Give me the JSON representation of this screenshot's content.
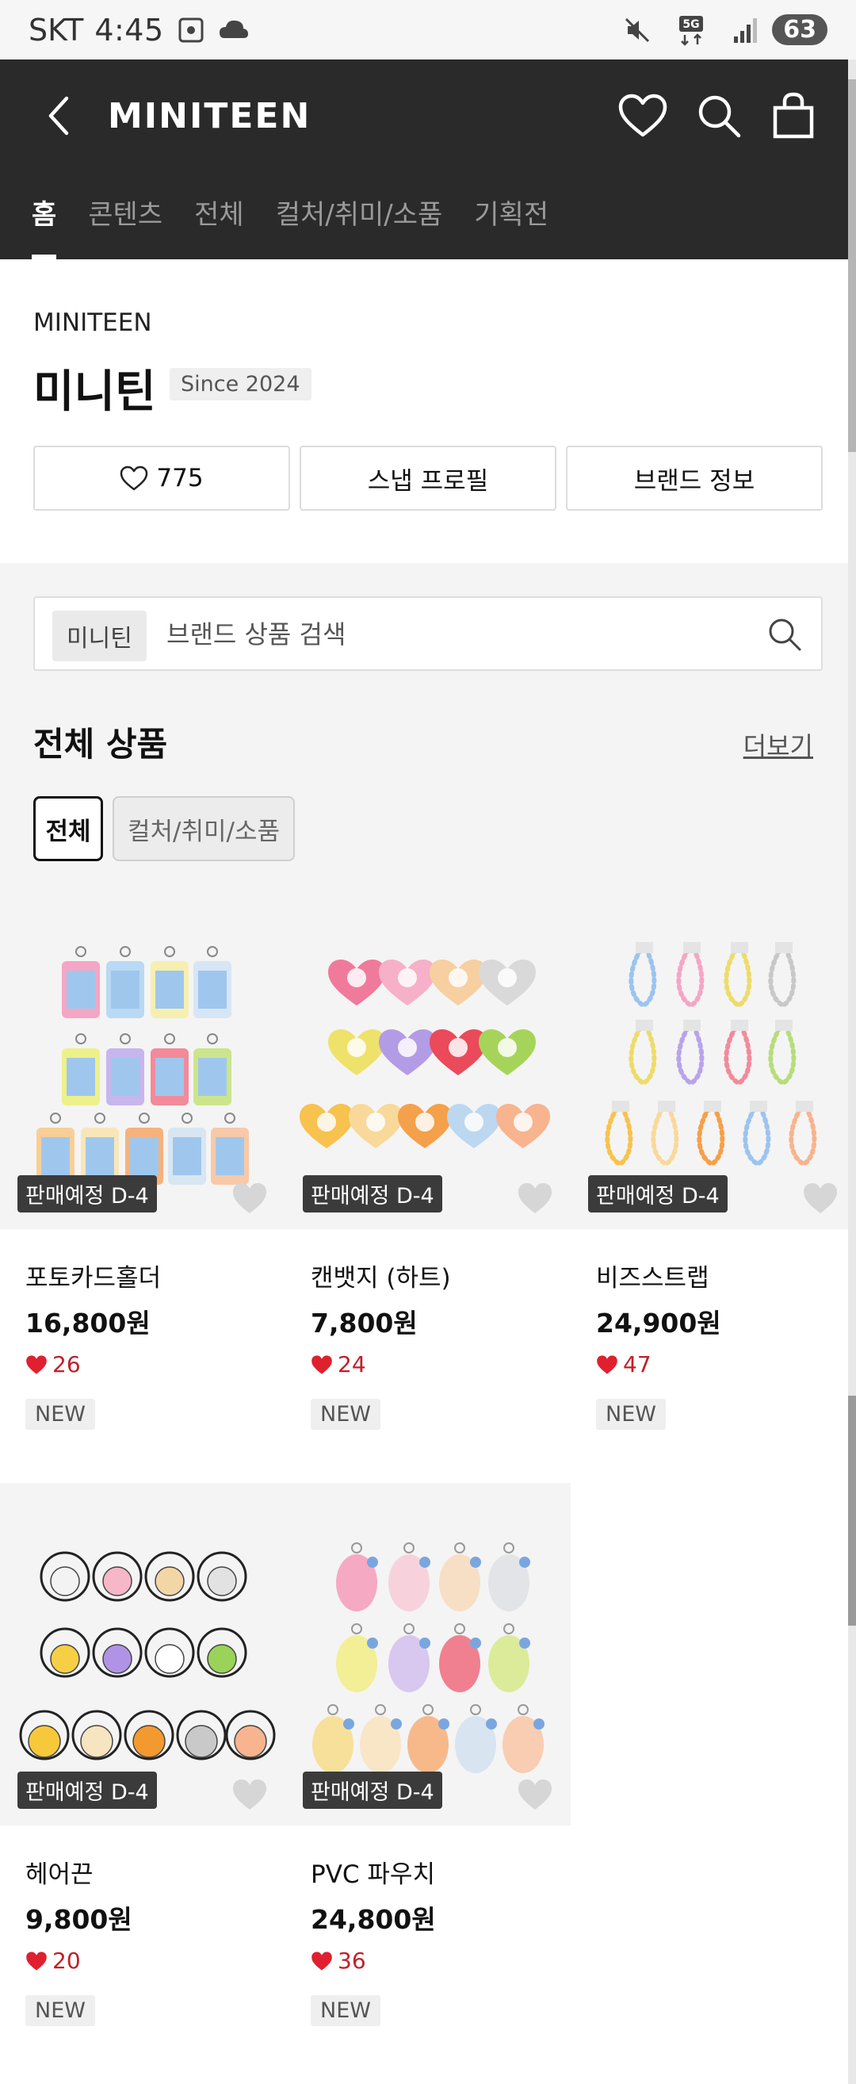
{
  "status_bar": {
    "carrier": "SKT",
    "time": "4:45",
    "battery": "63",
    "network": "5G"
  },
  "header": {
    "logo_text": "MINITEEN",
    "tabs": [
      {
        "label": "홈",
        "active": true
      },
      {
        "label": "콘텐츠",
        "active": false
      },
      {
        "label": "전체",
        "active": false
      },
      {
        "label": "컬처/취미/소품",
        "active": false
      },
      {
        "label": "기획전",
        "active": false
      }
    ]
  },
  "brand": {
    "name_en": "MINITEEN",
    "name_ko": "미니틴",
    "since": "Since 2024",
    "like_count": "775",
    "snap_profile_label": "스냅 프로필",
    "brand_info_label": "브랜드 정보"
  },
  "search": {
    "chip": "미니틴",
    "placeholder": "브랜드 상품 검색"
  },
  "section": {
    "title": "전체 상품",
    "more_label": "더보기",
    "filters": [
      {
        "label": "전체",
        "active": true
      },
      {
        "label": "컬처/취미/소품",
        "active": false
      }
    ]
  },
  "products": [
    {
      "name": "포토카드홀더",
      "price": "16,800원",
      "likes": "26",
      "badge": "판매예정 D-4",
      "tag": "NEW"
    },
    {
      "name": "캔뱃지 (하트)",
      "price": "7,800원",
      "likes": "24",
      "badge": "판매예정 D-4",
      "tag": "NEW"
    },
    {
      "name": "비즈스트랩",
      "price": "24,900원",
      "likes": "47",
      "badge": "판매예정 D-4",
      "tag": "NEW"
    },
    {
      "name": "헤어끈",
      "price": "9,800원",
      "likes": "20",
      "badge": "판매예정 D-4",
      "tag": "NEW"
    },
    {
      "name": "PVC 파우치",
      "price": "24,800원",
      "likes": "36",
      "badge": "판매예정 D-4",
      "tag": "NEW"
    }
  ],
  "colors": {
    "header_bg": "#2a2a2a",
    "like_red": "#e0202e",
    "badge_bg": "#3b3b3b"
  }
}
